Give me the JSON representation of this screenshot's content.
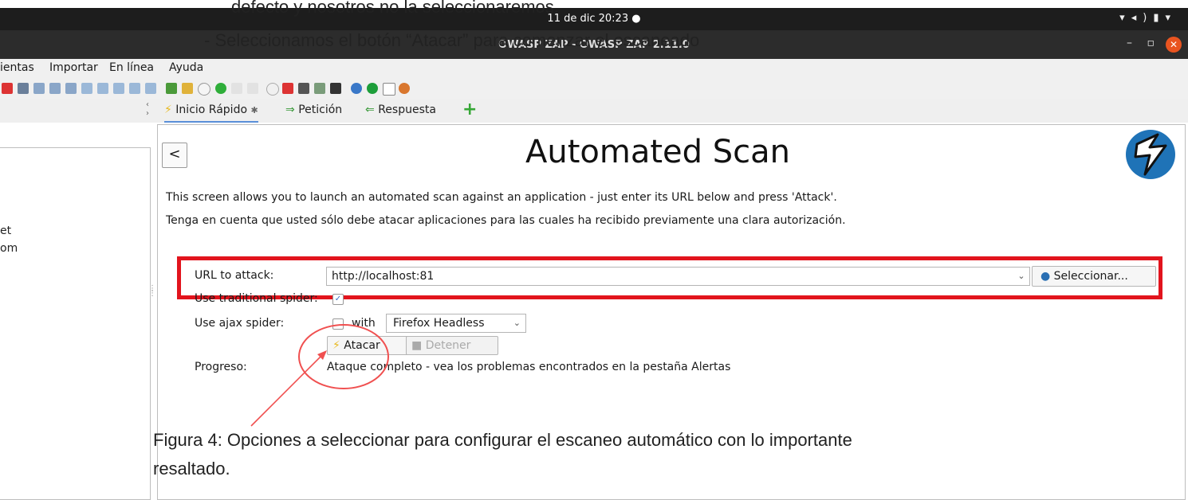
{
  "system_bar": {
    "clock": "11 de dic  20:23  ●"
  },
  "window": {
    "title": "OWASP ZAP - OWASP ZAP 2.11.0",
    "min_label": "–",
    "max_label": "▫",
    "close_label": "✕"
  },
  "document_overlay": {
    "line1": "defecto y nosotros no la seleccionaremos.",
    "line2": "-     Seleccionamos el botón “Atacar” para comenzar el escaneado"
  },
  "menu": {
    "items": [
      "ientas",
      "Importar",
      "En línea",
      "Ayuda"
    ]
  },
  "tabs": {
    "quick_start": "Inicio Rápido",
    "request": "Petición",
    "response": "Respuesta",
    "add": "+",
    "nav": "‹\n›"
  },
  "left_tree": {
    "items": [
      "et",
      "om"
    ]
  },
  "scan": {
    "back_label": "<",
    "title": "Automated Scan",
    "description": "This screen allows you to launch an automated scan against  an application - just enter its URL below and press 'Attack'.",
    "warning": "Tenga en cuenta que usted sólo debe atacar aplicaciones para las cuales ha recibido previamente una clara autorización.",
    "url_label": "URL to attack:",
    "url_value": "http://localhost:81",
    "select_button": "Seleccionar...",
    "traditional_label": "Use traditional spider:",
    "traditional_checked": true,
    "ajax_label": "Use ajax spider:",
    "ajax_checked": false,
    "with_label": "with",
    "browser": "Firefox Headless",
    "attack_button": "Atacar",
    "stop_button": "Detener",
    "progress_label": "Progreso:",
    "progress_text": "Ataque completo - vea los problemas encontrados en la pestaña Alertas"
  },
  "caption": {
    "line1": "Figura 4:  Opciones a seleccionar para configurar el   escaneo automático con lo importante",
    "line2": "resaltado."
  },
  "colors": {
    "highlight": "#e2141d",
    "annotation": "#f05050",
    "brand": "#1f73b7",
    "close": "#e95420",
    "tab_underline": "#5a8fd8"
  }
}
